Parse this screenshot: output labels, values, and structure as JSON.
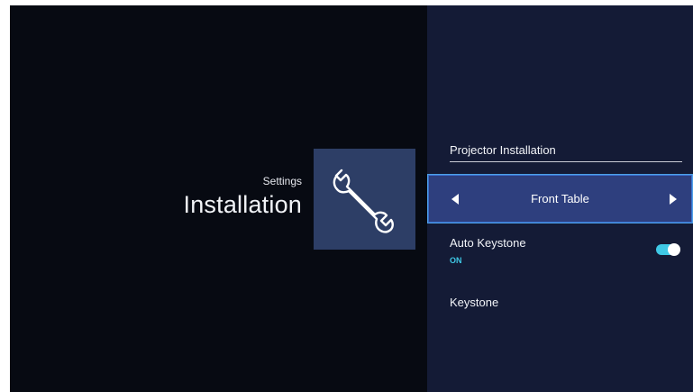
{
  "header": {
    "subtitle": "Settings",
    "title": "Installation",
    "icon": "wrench-icon"
  },
  "panel": {
    "section_title": "Projector Installation",
    "selector": {
      "value": "Front Table",
      "left_icon": "arrow-left-icon",
      "right_icon": "arrow-right-icon"
    },
    "auto_keystone": {
      "label": "Auto Keystone",
      "status": "ON",
      "enabled": true
    },
    "keystone": {
      "label": "Keystone"
    }
  },
  "colors": {
    "background": "#070a12",
    "panel": "#141b36",
    "tile": "#2d3e66",
    "selected_row": "#2e3f7e",
    "focus_border": "#4ea0e6",
    "accent": "#3fc9e6"
  }
}
